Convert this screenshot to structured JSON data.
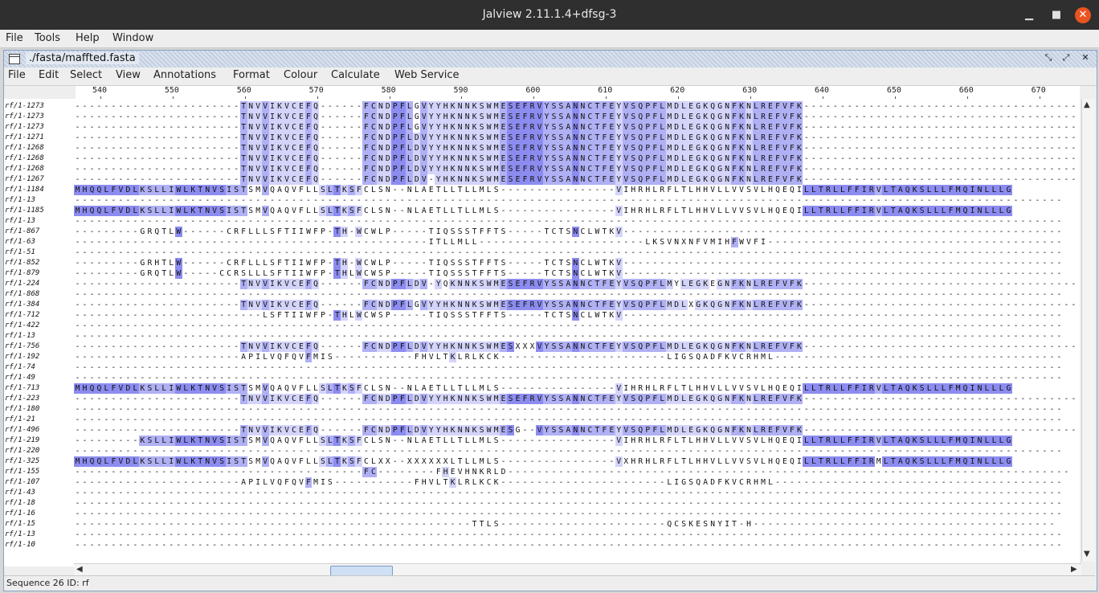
{
  "window": {
    "title": "Jalview 2.11.1.4+dfsg-3",
    "minimize_glyph": "▁",
    "maximize_glyph": "■",
    "close_glyph": "✕"
  },
  "main_menu": [
    "File",
    "Tools",
    "Help",
    "Window"
  ],
  "frame": {
    "title": "./fasta/maffted.fasta",
    "btn_restore": "⤡",
    "btn_max": "⤢",
    "btn_close": "✕"
  },
  "alignment_menu": [
    "File",
    "Edit",
    "Select",
    "View",
    "Annotations",
    "Format",
    "Colour",
    "Calculate",
    "Web Service"
  ],
  "ruler": {
    "start": 537,
    "ticks": [
      "540",
      "550",
      "560",
      "570",
      "580",
      "590",
      "600",
      "610",
      "620",
      "630",
      "640",
      "650",
      "660",
      "670"
    ]
  },
  "sequences": [
    {
      "id": "rf/1-1273",
      "seq": "-----------------------TNVVIKVCEFQ------FCNDPFLGVYYHKNNKSWMESEFRVYSSANNCTFEYVSQPFLMDLEGKQGNFKNLREFVFK-----------------------------------------"
    },
    {
      "id": "rf/1-1273",
      "seq": "-----------------------TNVVIKVCEFQ------FCNDPFLGVYYHKNNKSWMESEFRVYSSANNCTFEYVSQPFLMDLEGKQGNFKNLREFVFK-----------------------------------------"
    },
    {
      "id": "rf/1-1273",
      "seq": "-----------------------TNVVIKVCEFQ------FCNDPFLGVYYHKNNKSWMESEFRVYSSANNCTFEYVSQPFLMDLEGKQGNFKNLREFVFK-----------------------------------------"
    },
    {
      "id": "rf/1-1271",
      "seq": "-----------------------TNVVIKVCEFQ------FCNDPFLDVYYHKNNKSWMESEFRVYSSANNCTFEYVSQPFLMDLEGKQGNFKNLREFVFK-----------------------------------------"
    },
    {
      "id": "rf/1-1268",
      "seq": "-----------------------TNVVIKVCEFQ------FCNDPFLDVYYHKNNKSWMESEFRVYSSANNCTFEYVSQPFLMDLEGKQGNFKNLREFVFK-----------------------------------------"
    },
    {
      "id": "rf/1-1268",
      "seq": "-----------------------TNVVIKVCEFQ------FCNDPFLDVYYHKNNKSWMESEFRVYSSANNCTFEYVSQPFLMDLEGKQGNFKNLREFVFK-----------------------------------------"
    },
    {
      "id": "rf/1-1268",
      "seq": "-----------------------TNVVIKVCEFQ------FCNDPFLDVYYHKNNKSWMESEFRVYSSANNCTFEYVSQPFLMDLEGKQGNFKNLREFVFK-----------------------------------------"
    },
    {
      "id": "rf/1-1267",
      "seq": "-----------------------TNVVIKVCEFQ------FCNDPFLDV-YHKNNKSWMESEFRVYSSANNCTFEYVSQPFLMDLEGKQGNFKNLREFVFK-----------------------------------------"
    },
    {
      "id": "rf/1-1184",
      "seq": "MHQQLFVDLKSLLIWLKTNVSISTSMVQAQVFLLSLTKSFCLSN--NLAETLLTLLMLS----------------VIHRHLRFLTLHHVLLVVSVLHQEQILLTRLLFFIRVLTAQKSLLLFMQINLLLG"
    },
    {
      "id": "rf/1-13",
      "seq": "-----------------------------------------------------------------------------------------------------------------------------------------"
    },
    {
      "id": "rf/1-1185",
      "seq": "MHQQLFVDLKSLLIWLKTNVSISTSMVQAQVFLLSLTKSFCLSN--NLAETLLTLLMLS----------------VIHRHLRFLTLHHVLLVVSVLHQEQILLTRLLFFIRVLTAQKSLLLFMQINLLLG"
    },
    {
      "id": "rf/1-13",
      "seq": "-----------------------------------------------------------------------------------------------------------------------------------------"
    },
    {
      "id": "rf/1-867",
      "seq": "---------GRQTLW------CRFLLLSFTIIWFP-TH-WCWLP-----TIQSSSTFFTS-----TCTSNCLWTKV-------------------------------------------------------------"
    },
    {
      "id": "rf/1-63",
      "seq": "-------------------------------------------------ITLLMLL-----------------------LKSVNXNFVMIHFWVFI-----------------------------------------"
    },
    {
      "id": "rf/1-51",
      "seq": "-----------------------------------------------------------------------------------------------------------------------------------------"
    },
    {
      "id": "rf/1-852",
      "seq": "---------GRHTLW------CRFLLLSFTIIWFP-TH-WCWLP-----TIQSSSTFFTS-----TCTSNCLWTKV-------------------------------------------------------------"
    },
    {
      "id": "rf/1-879",
      "seq": "---------GRQTLW-----CCRSLLLSFTIIWFP-THLWCWSP-----TIQSSSTFFTS-----TCTSNCLWTKV-------------------------------------------------------------"
    },
    {
      "id": "rf/1-224",
      "seq": "-----------------------TNVVIKVCEFQ------FCNDPFLDV-YQKNNKSWMESEFRVYSSANNCTFEYVSQPFLMYLEGKEGNFKNLREFVFK-----------------------------------------"
    },
    {
      "id": "rf/1-868",
      "seq": "-----------------------------------------------------------------------------------------------------------------------------------------"
    },
    {
      "id": "rf/1-384",
      "seq": "-----------------------TNVVIKVCEFQ------FCNDPFLGVYYHKNNKSWMESEFRVYSSANNCTFEYVSQPFLMDLXGKQGNFKNLREFVFK-----------------------------------------"
    },
    {
      "id": "rf/1-712",
      "seq": "--------------------------LSFTIIWFP-THLWCWSP-----TIQSSSTFFTS-----TCTSNCLWTKV-------------------------------------------------------------"
    },
    {
      "id": "rf/1-422",
      "seq": "-----------------------------------------------------------------------------------------------------------------------------------------"
    },
    {
      "id": "rf/1-13",
      "seq": "-----------------------------------------------------------------------------------------------------------------------------------------"
    },
    {
      "id": "rf/1-756",
      "seq": "-----------------------TNVVIKVCEFQ------FCNDPFLDVYYHKNNKSWMESXXXVYSSANNCTFEYVSQPFLMDLEGKQGNFKNLREFVFK-----------------------------------------"
    },
    {
      "id": "rf/1-192",
      "seq": "-----------------------APILVQFQVFMIS-----------FHVLTKLRLKCK-----------------------LIGSQADFKVCRHML----------------------------------------"
    },
    {
      "id": "rf/1-74",
      "seq": "-----------------------------------------------------------------------------------------------------------------------------------------"
    },
    {
      "id": "rf/1-49",
      "seq": "-----------------------------------------------------------------------------------------------------------------------------------------"
    },
    {
      "id": "rf/1-713",
      "seq": "MHQQLFVDLKSLLIWLKTNVSISTSMVQAQVFLLSLTKSFCLSN--NLAETLLTLLMLS----------------VIHRHLRFLTLHHVLLVVSVLHQEQILLTRLLFFIRVLTAQKSLLLFMQINLLLG"
    },
    {
      "id": "rf/1-223",
      "seq": "-----------------------TNVVIKVCEFQ------FCNDPFLDVYYHKNNKSWMESEFRVYSSANNCTFEYVSQPFLMDLEGKQGNFKNLREFVFK-----------------------------------------"
    },
    {
      "id": "rf/1-180",
      "seq": "-----------------------------------------------------------------------------------------------------------------------------------------"
    },
    {
      "id": "rf/1-21",
      "seq": "-----------------------------------------------------------------------------------------------------------------------------------------"
    },
    {
      "id": "rf/1-496",
      "seq": "-----------------------TNVVIKVCEFQ------FCNDPFLDVYYHKNNKSWMESG--VYSSANNCTFEYVSQPFLMDLEGKQGNFKNLREFVFK-----------------------------------------"
    },
    {
      "id": "rf/1-219",
      "seq": "---------KSLLIWLKTNVSISTSMVQAQVFLLSLTKSFCLSN--NLAETLLTLLMLS----------------VIHRHLRFLTLHHVLLVVSVLHQEQILLTRLLFFIRVLTAQKSLLLFMQINLLLG"
    },
    {
      "id": "rf/1-220",
      "seq": "-----------------------------------------------------------------------------------------------------------------------------------------"
    },
    {
      "id": "rf/1-325",
      "seq": "MHQQLFVDLKSLLIWLKTNVSISTSMVQAQVFLLSLTKSFCLXX--XXXXXXLTLLMLS----------------VXHRHLRFLTLHHVLLVVSVLHQEQILLTRLLFFIRMLTAQKSLLLFMQINLLLG"
    },
    {
      "id": "rf/1-155",
      "seq": "----------------------------------------FC--------FHEVHNKRLD------------------------------------------------------------------------------"
    },
    {
      "id": "rf/1-107",
      "seq": "-----------------------APILVQFQVFMIS-----------FHVLTKLRLKCK-----------------------LIGSQADFKVCRHML----------------------------------------"
    },
    {
      "id": "rf/1-43",
      "seq": "-----------------------------------------------------------------------------------------------------------------------------------------"
    },
    {
      "id": "rf/1-18",
      "seq": "-----------------------------------------------------------------------------------------------------------------------------------------"
    },
    {
      "id": "rf/1-16",
      "seq": "-----------------------------------------------------------------------------------------------------------------------------------------"
    },
    {
      "id": "rf/1-15",
      "seq": "-------------------------------------------------------TTLS-----------------------QCSKESNYIT-H------------------------------------------"
    },
    {
      "id": "rf/1-13",
      "seq": "-----------------------------------------------------------------------------------------------------------------------------------------"
    },
    {
      "id": "rf/1-10",
      "seq": "-----------------------------------------------------------------------------------------------------------------------------------------"
    }
  ],
  "colours": {
    "high": "#8c8cf0",
    "mid": "#b0b0f4",
    "low": "#d4d4fa"
  },
  "status": "Sequence 26 ID: rf",
  "scroll": {
    "up": "▲",
    "down": "▼",
    "left": "◀",
    "right": "▶"
  }
}
